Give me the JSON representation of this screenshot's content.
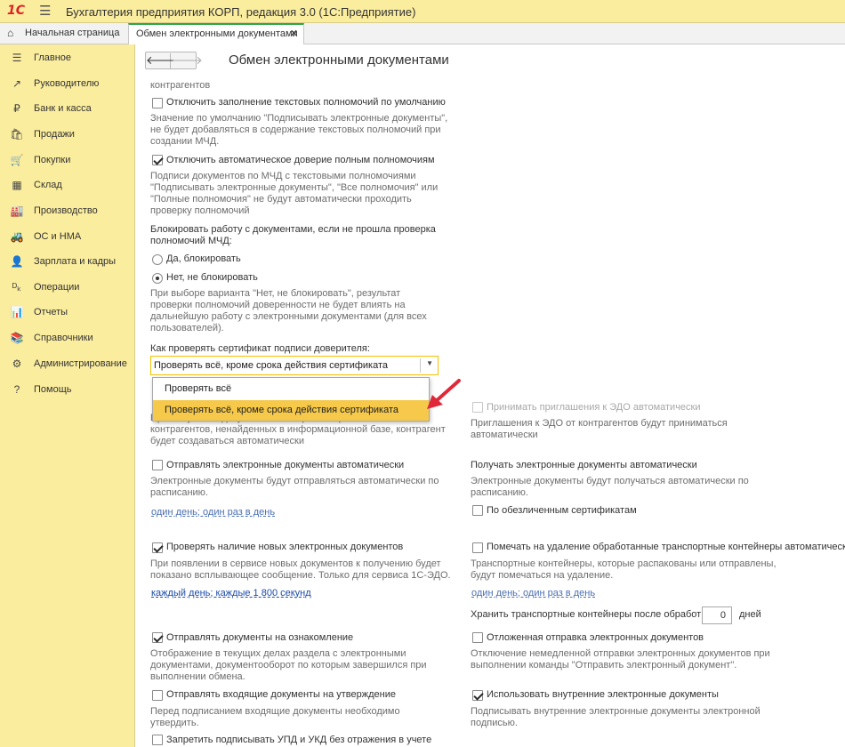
{
  "app": {
    "title": "Бухгалтерия предприятия КОРП, редакция 3.0  (1С:Предприятие)",
    "logo": "1C"
  },
  "tabs": [
    {
      "label": "Начальная страница",
      "icon": "home-icon"
    },
    {
      "label": "Обмен электронными документами",
      "close": "✕"
    }
  ],
  "sidebar": {
    "items": [
      {
        "label": "Главное",
        "icon": "☰"
      },
      {
        "label": "Руководителю",
        "icon": "↗"
      },
      {
        "label": "Банк и касса",
        "icon": "₽"
      },
      {
        "label": "Продажи",
        "icon": "🛍"
      },
      {
        "label": "Покупки",
        "icon": "🛒"
      },
      {
        "label": "Склад",
        "icon": "▦"
      },
      {
        "label": "Производство",
        "icon": "🏭"
      },
      {
        "label": "ОС и НМА",
        "icon": "🚜"
      },
      {
        "label": "Зарплата и кадры",
        "icon": "👤"
      },
      {
        "label": "Операции",
        "icon": "ᴰₖ"
      },
      {
        "label": "Отчеты",
        "icon": "📊"
      },
      {
        "label": "Справочники",
        "icon": "📚"
      },
      {
        "label": "Администрирование",
        "icon": "⚙"
      },
      {
        "label": "Помощь",
        "icon": "?"
      }
    ]
  },
  "page": {
    "title": "Обмен электронными документами",
    "nav_back": "🡐",
    "nav_forward": "🡒"
  },
  "left": {
    "cut_text": "контрагентов",
    "opt_disable_text_powers": {
      "label": "Отключить заполнение текстовых полномочий по умолчанию",
      "checked": false
    },
    "hint_text_powers": [
      "Значение по умолчанию \"Подписывать электронные документы\",",
      "не будет добавляться в содержание текстовых полномочий при",
      "создании МЧД."
    ],
    "opt_disable_full_trust": {
      "label": "Отключить автоматическое доверие полным полномочиям",
      "checked": true
    },
    "hint_full_trust": [
      "Подписи документов по МЧД с текстовыми полномочиями",
      "\"Подписывать электронные документы\", \"Все полномочия\" или",
      "\"Полные полномочия\" не будут автоматически проходить",
      "проверку полномочий"
    ],
    "block_label": [
      "Блокировать работу с документами, если не прошла проверка",
      "полномочий МЧД:"
    ],
    "radio_yes": "Да, блокировать",
    "radio_no": "Нет, не блокировать",
    "hint_no_block": [
      "При выборе варианта \"Нет, не блокировать\", результат",
      "проверки полномочий доверенности не будет влиять на",
      "дальнейшую работу с электронными документами (для всех",
      "пользователей)."
    ],
    "cert_label": "Как проверять сертификат подписи доверителя:",
    "cert_value": "Проверять всё, кроме срока действия сертификата",
    "dropdown_options": [
      "Проверять всё",
      "Проверять всё, кроме срока действия сертификата"
    ],
    "hint_invites": [
      "При получении документов или приеме приглашений от",
      "контрагентов, ненайденных в информационной базе, контрагент",
      "будет создаваться автоматически"
    ],
    "opt_send_auto": {
      "label": "Отправлять электронные документы автоматически",
      "checked": false
    },
    "hint_send_auto": [
      "Электронные документы будут отправляться автоматически по",
      "расписанию."
    ],
    "send_schedule": "один день; один раз в день",
    "opt_check_new": {
      "label": "Проверять наличие новых электронных документов",
      "checked": true
    },
    "hint_check_new": [
      "При появлении в сервисе новых документов к получению будет",
      "показано всплывающее сообщение. Только для сервиса 1С-ЭДО."
    ],
    "check_schedule": "каждый день; каждые 1 800 секунд",
    "opt_send_review": {
      "label": "Отправлять документы на ознакомление",
      "checked": true
    },
    "hint_send_review": [
      "Отображение в текущих делах  раздела с электронными",
      "документами, документооборот по которым завершился при",
      "выполнении обмена."
    ],
    "opt_send_incoming": {
      "label": "Отправлять входящие документы на утверждение",
      "checked": false
    },
    "hint_send_incoming": [
      "Перед подписанием входящие документы необходимо",
      "утвердить."
    ],
    "opt_forbid_sign": {
      "label": "Запретить подписывать УПД и УКД без отражения в учете",
      "checked": false
    }
  },
  "right": {
    "opt_accept_invites": {
      "label": "Принимать приглашения к ЭДО автоматически",
      "checked": false
    },
    "hint_accept_invites": [
      "Приглашения к ЭДО от контрагентов будут приниматься",
      "автоматически"
    ],
    "receive_title": "Получать электронные документы автоматически",
    "hint_receive": [
      "Электронные документы будут получаться автоматически по",
      "расписанию."
    ],
    "opt_impersonal": {
      "label": "По обезличенным сертификатам",
      "checked": false
    },
    "opt_mark_delete": {
      "label": "Помечать на удаление обработанные транспортные контейнеры автоматически",
      "checked": false
    },
    "hint_mark_delete": [
      "Транспортные контейнеры, которые распакованы или отправлены,",
      "будут помечаться на удаление."
    ],
    "delete_schedule": "один день; один раз в день",
    "keep_label": "Хранить транспортные контейнеры после обработки:",
    "keep_value": "0",
    "keep_unit": "дней",
    "opt_deferred": {
      "label": "Отложенная отправка электронных документов",
      "checked": false
    },
    "hint_deferred": [
      "Отключение немедленной отправки электронных документов при",
      "выполнении команды \"Отправить электронный документ\"."
    ],
    "opt_internal": {
      "label": "Использовать внутренние электронные документы",
      "checked": true
    },
    "hint_internal": [
      "Подписывать внутренние электронные документы электронной",
      "подписью."
    ]
  },
  "colors": {
    "panel_yellow": "#fbed9e",
    "highlight": "#f6c94a",
    "link": "#4a6fb1",
    "accent_tab": "#2da44e",
    "arrow": "#e0283a"
  }
}
